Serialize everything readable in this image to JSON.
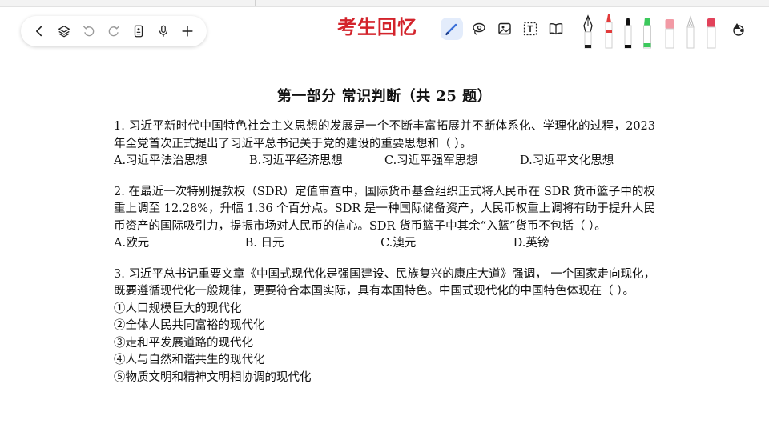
{
  "app": {
    "handwritten_title": "考生回忆",
    "top_strip_color": "#f3f3f3"
  },
  "nav": {
    "items": [
      {
        "name": "back",
        "icon": "chevron-left-icon"
      },
      {
        "name": "layers",
        "icon": "layers-icon"
      },
      {
        "name": "undo",
        "icon": "undo-icon"
      },
      {
        "name": "redo",
        "icon": "redo-icon"
      },
      {
        "name": "page-template",
        "icon": "document-icon"
      },
      {
        "name": "voice",
        "icon": "microphone-icon"
      },
      {
        "name": "add",
        "icon": "plus-icon"
      }
    ]
  },
  "toolbar": {
    "active_tool": "pen",
    "tools": [
      "pen-icon",
      "lasso-icon",
      "image-icon",
      "text-box-icon",
      "book-icon"
    ],
    "pens": [
      {
        "name": "fountain-pen",
        "color": "#1f1f1f"
      },
      {
        "name": "red-pen",
        "color": "#e23b3b"
      },
      {
        "name": "black-marker",
        "color": "#111111"
      },
      {
        "name": "green-highlighter",
        "color": "#3cc95c"
      },
      {
        "name": "pink-eraser",
        "color": "#f29aa5"
      },
      {
        "name": "pencil",
        "color": "#b8b8b8"
      },
      {
        "name": "red-eraser",
        "color": "#e2425a"
      },
      {
        "name": "shapes",
        "color": "#222222"
      }
    ],
    "accent_color": "#3b6fd8"
  },
  "document": {
    "title": "第一部分  常识判断（共 25 题）",
    "q1": {
      "text": "1. 习近平新时代中国特色社会主义思想的发展是一个不断丰富拓展并不断体系化、学理化的过程，2023 年全党首次正式提出了习近平总书记关于党的建设的重要思想和（    ）。",
      "options": [
        "A.习近平法治思想",
        "B.习近平经济思想",
        "C.习近平强军思想",
        "D.习近平文化思想"
      ]
    },
    "q2": {
      "text": "2. 在最近一次特别提款权（SDR）定值审查中，国际货币基金组织正式将人民币在 SDR 货币篮子中的权重上调至 12.28%，升幅 1.36 个百分点。SDR 是一种国际储备资产，人民币权重上调将有助于提升人民币资产的国际吸引力，提振市场对人民币的信心。SDR 货币篮子中其余“入篮”货币不包括（    ）。",
      "options": [
        "A.欧元",
        "B. 日元",
        "C.澳元",
        "D.英镑"
      ]
    },
    "q3": {
      "text": "3. 习近平总书记重要文章《中国式现代化是强国建设、民族复兴的康庄大道》强调， 一个国家走向现化，既要遵循现代化一般规律，更要符合本国实际，具有本国特色。中国式现代化的中国特色体现在（    ）。",
      "items": [
        "①人口规模巨大的现代化",
        "②全体人民共同富裕的现代化",
        "③走和平发展道路的现代化",
        "④人与自然和谐共生的现代化",
        "⑤物质文明和精神文明相协调的现代化"
      ]
    }
  }
}
